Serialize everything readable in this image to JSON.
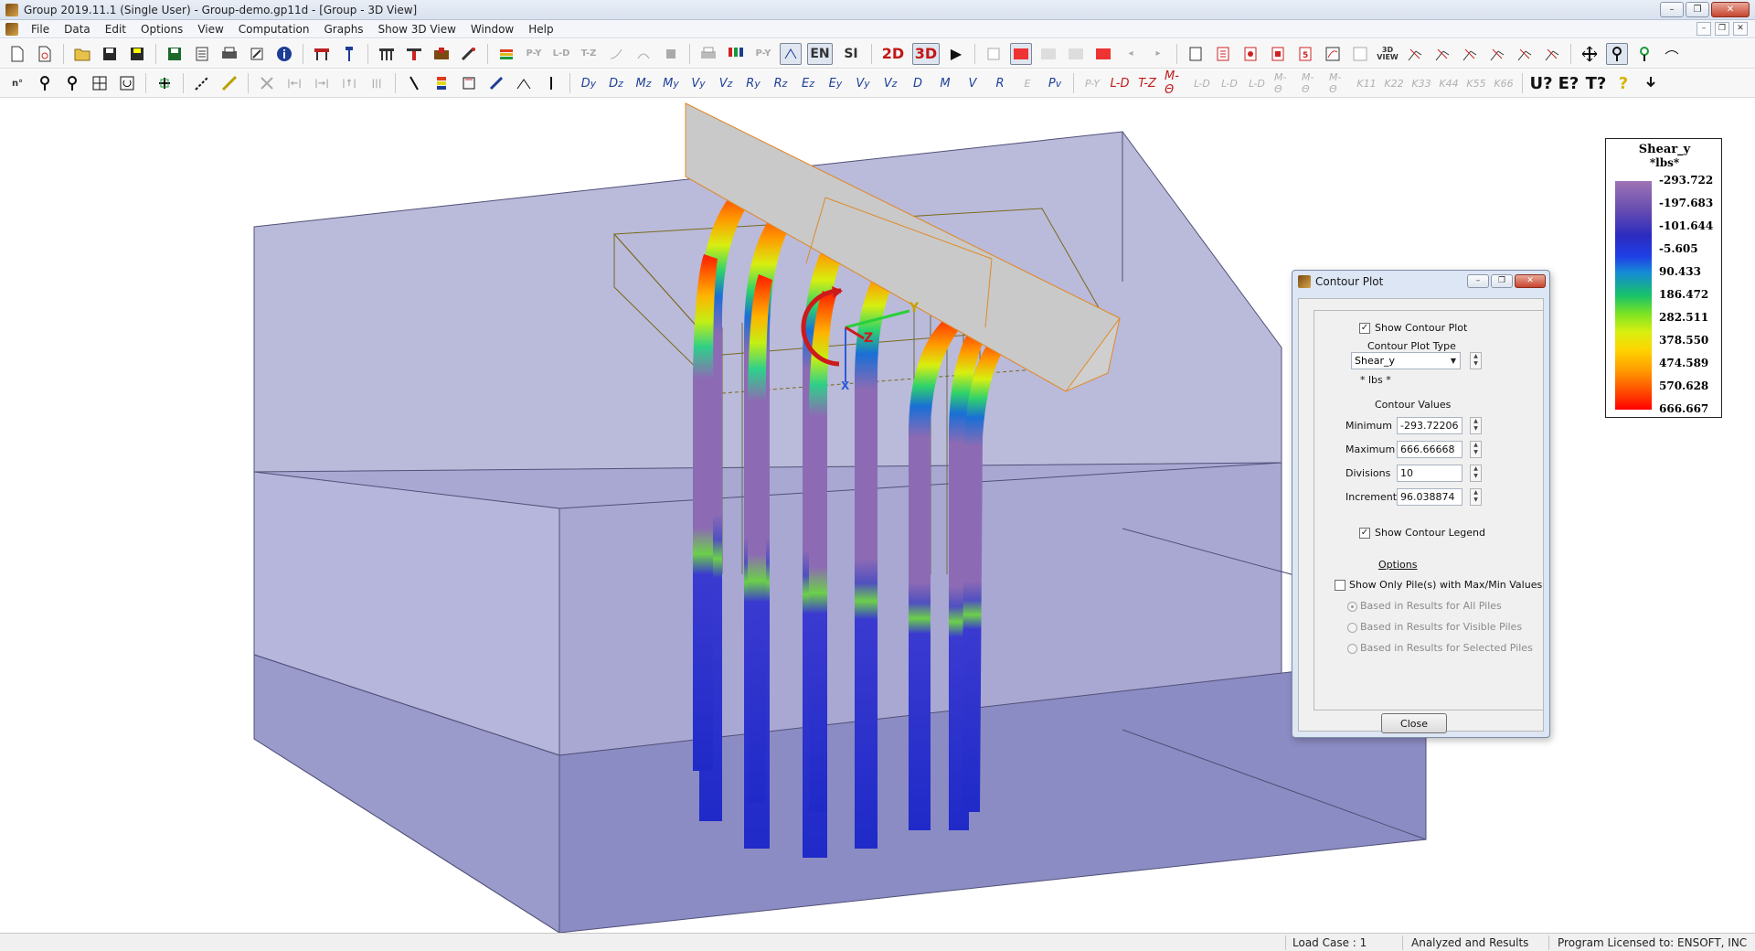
{
  "window": {
    "title": "Group 2019.11.1 (Single User) - Group-demo.gp11d - [Group - 3D View]",
    "minimize": "–",
    "restore": "❐",
    "close": "✕"
  },
  "menu": {
    "items": [
      "File",
      "Data",
      "Edit",
      "Options",
      "View",
      "Computation",
      "Graphs",
      "Show 3D View",
      "Window",
      "Help"
    ]
  },
  "toolbar": {
    "en_label": "EN",
    "si_label": "SI",
    "view2d_label": "2D",
    "view3d_label": "3D",
    "view3d_small": "3D VIEW",
    "help_u": "U?",
    "help_e": "E?",
    "help_t": "T?",
    "help_q": "?"
  },
  "legend": {
    "title": "Shear_y",
    "unit": "*lbs*",
    "values": [
      "-293.722",
      "-197.683",
      "-101.644",
      "-5.605",
      "90.433",
      "186.472",
      "282.511",
      "378.550",
      "474.589",
      "570.628",
      "666.667"
    ]
  },
  "dialog": {
    "title": "Contour Plot",
    "show_contour_plot": "Show Contour Plot",
    "show_contour_plot_checked": true,
    "plot_type_label": "Contour Plot Type",
    "plot_type_value": "Shear_y",
    "unit_label": "* lbs *",
    "contour_values_label": "Contour Values",
    "minimum_label": "Minimum",
    "minimum_value": "-293.72206",
    "maximum_label": "Maximum",
    "maximum_value": "666.66668",
    "divisions_label": "Divisions",
    "divisions_value": "10",
    "increment_label": "Increment",
    "increment_value": "96.038874",
    "show_legend": "Show Contour Legend",
    "show_legend_checked": true,
    "options_label": "Options",
    "show_only_piles": "Show Only Pile(s) with Max/Min Values",
    "show_only_piles_checked": false,
    "radio_all": "Based in Results for All Piles",
    "radio_visible": "Based in Results for Visible Piles",
    "radio_selected": "Based in Results for Selected Piles",
    "close_button": "Close"
  },
  "axes": {
    "x": "X",
    "y": "Y",
    "z": "Z"
  },
  "status": {
    "load_case": "Load Case : 1",
    "analysis": "Analyzed and Results",
    "license": "Program Licensed to: ENSOFT, INC"
  },
  "colors": {
    "soil_layer": "#aeaed8",
    "soil_dark": "#8585c0",
    "pile_cap": "#c9c9c9",
    "accent_red": "#c41515"
  }
}
